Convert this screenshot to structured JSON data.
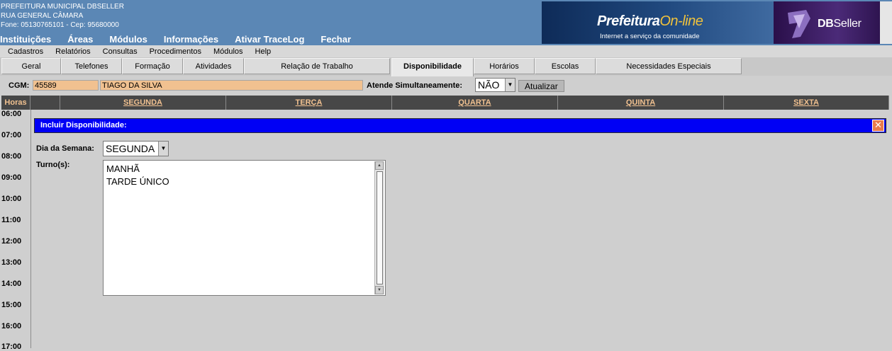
{
  "header": {
    "org": "PREFEITURA MUNICIPAL DBSELLER",
    "street": "RUA GENERAL CÂMARA",
    "contact": "Fone: 05130765101  -  Cep: 95680000",
    "banner": {
      "logo_main": "Prefeitura",
      "logo_accent": "On-line",
      "slogan": "Internet a serviço da comunidade",
      "db_bold": "DB",
      "db_rest": "Seller"
    },
    "main_menu": [
      "Instituições",
      "Áreas",
      "Módulos",
      "Informações",
      "Ativar TraceLog",
      "Fechar"
    ]
  },
  "sub_menu": [
    "Cadastros",
    "Relatórios",
    "Consultas",
    "Procedimentos",
    "Módulos",
    "Help"
  ],
  "tabs": [
    "Geral",
    "Telefones",
    "Formação",
    "Atividades",
    "Relação de Trabalho",
    "Disponibilidade",
    "Horários",
    "Escolas",
    "Necessidades Especiais"
  ],
  "active_tab": "Disponibilidade",
  "form": {
    "cgm_label": "CGM:",
    "cgm_value": "45589",
    "name_value": "TIAGO DA SILVA",
    "simult_label": "Atende Simultaneamente:",
    "simult_value": "NÃO",
    "update_button": "Atualizar"
  },
  "grid": {
    "hours_header": "Horas",
    "days": [
      "SEGUNDA",
      "TERÇA",
      "QUARTA",
      "QUINTA",
      "SEXTA"
    ],
    "hours": [
      "06:00",
      "07:00",
      "08:00",
      "09:00",
      "10:00",
      "11:00",
      "12:00",
      "13:00",
      "14:00",
      "15:00",
      "16:00",
      "17:00"
    ]
  },
  "dialog": {
    "title": "Incluir Disponibilidade:",
    "close_glyph": "✕",
    "day_label": "Dia da Semana:",
    "day_value": "SEGUNDA",
    "shift_label": "Turno(s):",
    "shifts": [
      "MANHÃ",
      "TARDE ÚNICO"
    ]
  },
  "icons": {
    "dropdown": "chevron-down-icon",
    "close": "close-icon",
    "scroll_up": "scroll-up-icon",
    "scroll_down": "scroll-down-icon"
  },
  "colors": {
    "header_bg": "#5b87b5",
    "dialog_bar": "#0000f5",
    "field_bg": "#f1c190",
    "grid_header_bg": "#474747",
    "grid_header_text": "#f1c190"
  }
}
